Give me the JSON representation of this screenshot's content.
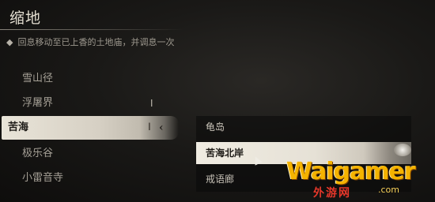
{
  "header": {
    "title": "缩地",
    "hint_icon": "diamond-bullet-icon",
    "hint": "回息移动至已上香的土地庙，并调息一次"
  },
  "locations": [
    {
      "label": "雪山径",
      "selected": false
    },
    {
      "label": "浮屠界",
      "selected": false,
      "tick": "ǀ"
    },
    {
      "label": "苦海",
      "selected": true,
      "tick": "ǀ",
      "chevron": "‹"
    },
    {
      "label": "极乐谷",
      "selected": false
    },
    {
      "label": "小雷音寺",
      "selected": false
    }
  ],
  "sub_locations": [
    {
      "label": "龟岛",
      "selected": false
    },
    {
      "label": "苦海北岸",
      "selected": true
    },
    {
      "label": "戒语廊",
      "selected": false
    }
  ],
  "watermark": {
    "logo": "Waigamer",
    "suffix": ".com",
    "cn": "外游网"
  }
}
